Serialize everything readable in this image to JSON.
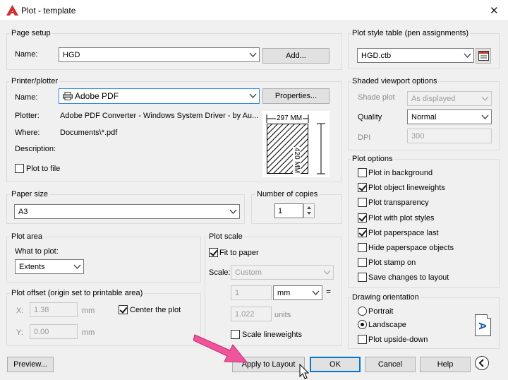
{
  "window": {
    "title": "Plot - template",
    "close_glyph": "✕"
  },
  "page_setup": {
    "group_label": "Page setup",
    "name_label": "Name:",
    "name_value": "HGD",
    "add_button": "Add..."
  },
  "printer": {
    "group_label": "Printer/plotter",
    "name_label": "Name:",
    "name_value": "Adobe PDF",
    "properties_button": "Properties...",
    "plotter_label": "Plotter:",
    "plotter_value": "Adobe PDF Converter - Windows System Driver - by Au...",
    "where_label": "Where:",
    "where_value": "Documents\\*.pdf",
    "description_label": "Description:",
    "plot_to_file_label": "Plot to file",
    "plot_to_file_checked": false,
    "preview_width": "297 MM",
    "preview_height": "420 MM"
  },
  "paper_size": {
    "group_label": "Paper size",
    "value": "A3"
  },
  "copies": {
    "group_label": "Number of copies",
    "value": "1"
  },
  "plot_area": {
    "group_label": "Plot area",
    "what_label": "What to plot:",
    "what_value": "Extents"
  },
  "plot_offset": {
    "group_label": "Plot offset (origin set to printable area)",
    "x_label": "X:",
    "x_value": "1.38",
    "x_unit": "mm",
    "y_label": "Y:",
    "y_value": "0.00",
    "y_unit": "mm",
    "center_label": "Center the plot",
    "center_checked": true
  },
  "plot_scale": {
    "group_label": "Plot scale",
    "fit_label": "Fit to paper",
    "fit_checked": true,
    "scale_label": "Scale:",
    "scale_value": "Custom",
    "value1": "1",
    "unit1": "mm",
    "equals": "=",
    "value2": "1.022",
    "unit2": "units",
    "lineweights_label": "Scale lineweights",
    "lineweights_checked": false
  },
  "plot_style": {
    "group_label": "Plot style table (pen assignments)",
    "value": "HGD.ctb"
  },
  "shaded": {
    "group_label": "Shaded viewport options",
    "shade_label": "Shade plot",
    "shade_value": "As displayed",
    "quality_label": "Quality",
    "quality_value": "Normal",
    "dpi_label": "DPI",
    "dpi_value": "300"
  },
  "plot_options": {
    "group_label": "Plot options",
    "items": [
      {
        "label": "Plot in background",
        "checked": false
      },
      {
        "label": "Plot object lineweights",
        "checked": true
      },
      {
        "label": "Plot transparency",
        "checked": false
      },
      {
        "label": "Plot with plot styles",
        "checked": true
      },
      {
        "label": "Plot paperspace last",
        "checked": true
      },
      {
        "label": "Hide paperspace objects",
        "checked": false
      },
      {
        "label": "Plot stamp on",
        "checked": false
      },
      {
        "label": "Save changes to layout",
        "checked": false
      }
    ]
  },
  "orientation": {
    "group_label": "Drawing orientation",
    "portrait_label": "Portrait",
    "landscape_label": "Landscape",
    "selected": "Landscape",
    "upside_down_label": "Plot upside-down",
    "upside_down_checked": false,
    "icon_letter": "A"
  },
  "footer": {
    "preview_button": "Preview...",
    "apply_button": "Apply to Layout",
    "ok_button": "OK",
    "cancel_button": "Cancel",
    "help_button": "Help"
  },
  "colors": {
    "accent": "#0078d7",
    "annotation_arrow": "#f2549c",
    "app_icon": "#d42a2a"
  }
}
